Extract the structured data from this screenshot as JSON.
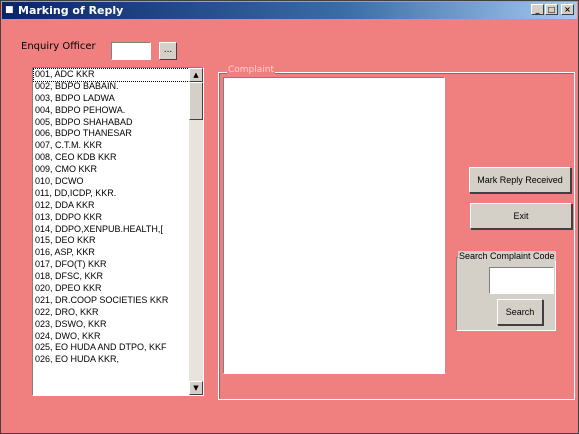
{
  "window": {
    "title": "Marking of Reply",
    "controls": [
      "_",
      "□",
      "×"
    ]
  },
  "enquiry": {
    "label": "Enquiry Officer",
    "browse_label": "..."
  },
  "officers": [
    "001, ADC KKR",
    "002, BDPO BABAIN.",
    "003, BDPO LADWA",
    "004, BDPO PEHOWA.",
    "005, BDPO SHAHABAD",
    "006, BDPO THANESAR",
    "007, C.T.M. KKR",
    "008, CEO KDB KKR",
    "009, CMO KKR",
    "010, DCWO",
    "011, DD,ICDP, KKR.",
    "012, DDA KKR",
    "013, DDPO KKR",
    "014, DDPO,XENPUB.HEALTH,[",
    "015, DEO KKR",
    "016, ASP, KKR",
    "017, DFO(T) KKR",
    "018, DFSC, KKR",
    "020, DPEO KKR",
    "021, DR.COOP SOCIETIES KKR",
    "022, DRO, KKR",
    "023, DSWO, KKR",
    "024, DWO, KKR",
    "025, EO HUDA AND DTPO, KKF",
    "026, EO HUDA KKR,"
  ],
  "complaint": {
    "caption": "Complaint"
  },
  "buttons": {
    "mark_reply": "Mark Reply Received",
    "exit": "Exit",
    "search": "Search"
  },
  "search_group": {
    "caption": "Search Complaint Code"
  }
}
